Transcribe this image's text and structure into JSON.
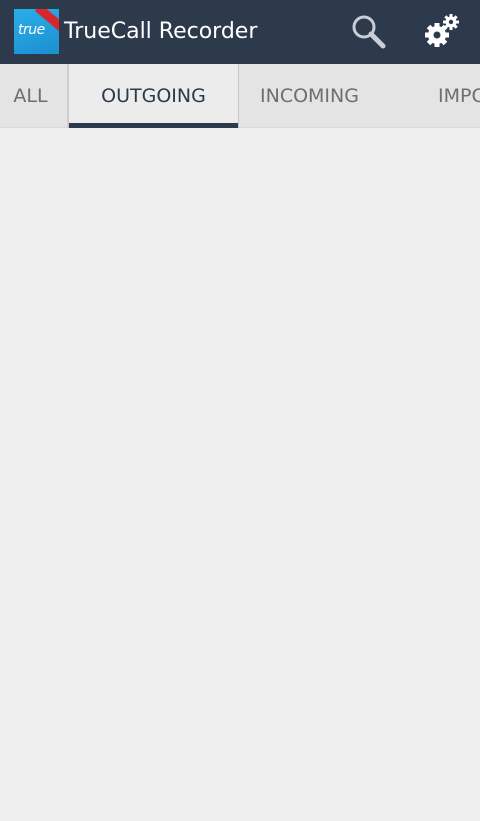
{
  "app": {
    "title": "TrueCall Recorder",
    "icon_text": "true",
    "icon_name": "truecall-app-icon"
  },
  "actions": {
    "search_icon": "search-icon",
    "settings_icon": "settings-gears-icon"
  },
  "tabs": [
    {
      "label": "ALL"
    },
    {
      "label": "OUTGOING",
      "selected": true
    },
    {
      "label": "INCOMING"
    },
    {
      "label": "IMPO"
    }
  ],
  "colors": {
    "action_bar": "#2c3a4c",
    "tab_bar": "#e4e4e4",
    "background": "#efefef",
    "indicator": "#2c3a4c"
  }
}
